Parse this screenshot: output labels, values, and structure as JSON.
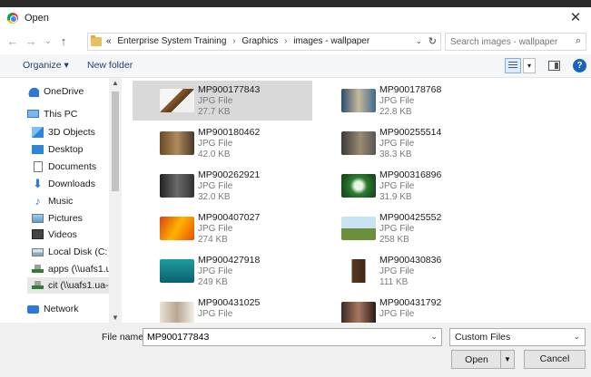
{
  "window": {
    "title": "Open",
    "close_glyph": "✕"
  },
  "nav_buttons": {
    "back": "←",
    "forward": "→",
    "recent": "⌄",
    "up": "↑"
  },
  "breadcrumb": {
    "prefix": "«",
    "parts": [
      "Enterprise System Training",
      "Graphics",
      "images - wallpaper"
    ],
    "separator": "›",
    "dropdown_glyph": "⌄",
    "refresh_glyph": "↻"
  },
  "search": {
    "placeholder": "Search images - wallpaper",
    "icon": "⌕"
  },
  "toolbar": {
    "organize_label": "Organize ▾",
    "new_folder_label": "New folder",
    "help_glyph": "?",
    "view_drop": "▾"
  },
  "navigation": {
    "items": [
      {
        "label": "OneDrive",
        "icon": "onedrive-icon"
      },
      {
        "label": "This PC",
        "icon": "pc-icon"
      },
      {
        "label": "3D Objects",
        "icon": "3d-objects-icon"
      },
      {
        "label": "Desktop",
        "icon": "desktop-icon"
      },
      {
        "label": "Documents",
        "icon": "documents-icon"
      },
      {
        "label": "Downloads",
        "icon": "downloads-icon"
      },
      {
        "label": "Music",
        "icon": "music-icon"
      },
      {
        "label": "Pictures",
        "icon": "pictures-icon"
      },
      {
        "label": "Videos",
        "icon": "videos-icon"
      },
      {
        "label": "Local Disk (C:)",
        "icon": "disk-icon"
      },
      {
        "label": "apps (\\\\uafs1.ua",
        "icon": "network-drive-icon"
      },
      {
        "label": "cit (\\\\uafs1.ua-n",
        "icon": "network-drive-icon",
        "selected": true
      },
      {
        "label": "Network",
        "icon": "network-icon"
      }
    ]
  },
  "files": [
    {
      "name": "MP900177843",
      "type": "JPG File",
      "size": "27.7 KB",
      "selected": true
    },
    {
      "name": "MP900178768",
      "type": "JPG File",
      "size": "22.8 KB"
    },
    {
      "name": "MP900180462",
      "type": "JPG File",
      "size": "42.0 KB"
    },
    {
      "name": "MP900255514",
      "type": "JPG File",
      "size": "38.3 KB"
    },
    {
      "name": "MP900262921",
      "type": "JPG File",
      "size": "32.0 KB"
    },
    {
      "name": "MP900316896",
      "type": "JPG File",
      "size": "31.9 KB"
    },
    {
      "name": "MP900407027",
      "type": "JPG File",
      "size": "274 KB"
    },
    {
      "name": "MP900425552",
      "type": "JPG File",
      "size": "258 KB"
    },
    {
      "name": "MP900427918",
      "type": "JPG File",
      "size": "249 KB"
    },
    {
      "name": "MP900430836",
      "type": "JPG File",
      "size": "111 KB"
    },
    {
      "name": "MP900431025",
      "type": "JPG File",
      "size": ""
    },
    {
      "name": "MP900431792",
      "type": "JPG File",
      "size": ""
    }
  ],
  "footer": {
    "file_name_label": "File name:",
    "file_name_value": "MP900177843",
    "file_type_value": "Custom Files",
    "open_label": "Open",
    "cancel_label": "Cancel",
    "dropdown_glyph": "⌄"
  }
}
